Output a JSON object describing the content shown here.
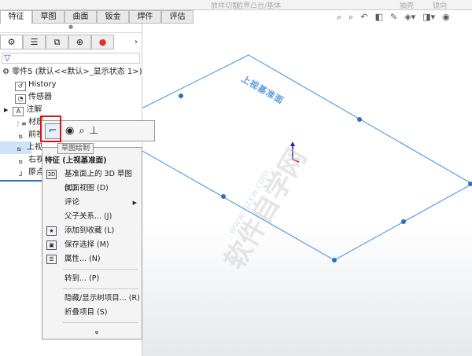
{
  "ribbon": {
    "items": [
      "边界凸台/基体",
      "放样切割",
      "抽壳",
      "镜向"
    ]
  },
  "tabs": [
    "特征",
    "草图",
    "曲面",
    "钣金",
    "焊件",
    "评估"
  ],
  "view_icons": [
    "zoom-fit-icon",
    "zoom-area-icon",
    "previous-view-icon",
    "section-view-icon",
    "dynamic-annotation-icon",
    "view-orientation-icon",
    "display-style-icon",
    "hide-show-icon"
  ],
  "panel": {
    "tabs": [
      "feature-manager",
      "property-manager",
      "configuration-manager",
      "dimxpert-manager",
      "display-manager"
    ],
    "filter_icon": "▽",
    "tree": {
      "root": "零件5 (默认<<默认>_显示状态 1>)",
      "items": [
        "History",
        "传感器",
        "注解",
        "材质",
        "前视",
        "上视",
        "右视",
        "原点"
      ]
    }
  },
  "popup_toolbar": {
    "tooltip": "草图绘制"
  },
  "context_menu": {
    "header": "特征 (上视基准面)",
    "items": [
      "基准面上的 3D 草图 (C)",
      "剖面视图 (D)",
      "评论",
      "父子关系... (J)",
      "添加到收藏 (L)",
      "保存选择 (M)",
      "属性... (N)",
      "转到... (P)",
      "隐藏/显示树项目... (R)",
      "折叠项目 (S)"
    ],
    "more": "»"
  },
  "viewport": {
    "plane_label": "上视基准面"
  },
  "watermark": {
    "title": "软件自学网",
    "url": "www.rjzxw.com"
  },
  "colors": {
    "plane": "#3a8ee8",
    "highlight": "#e01010",
    "selection": "#cde3f7"
  }
}
